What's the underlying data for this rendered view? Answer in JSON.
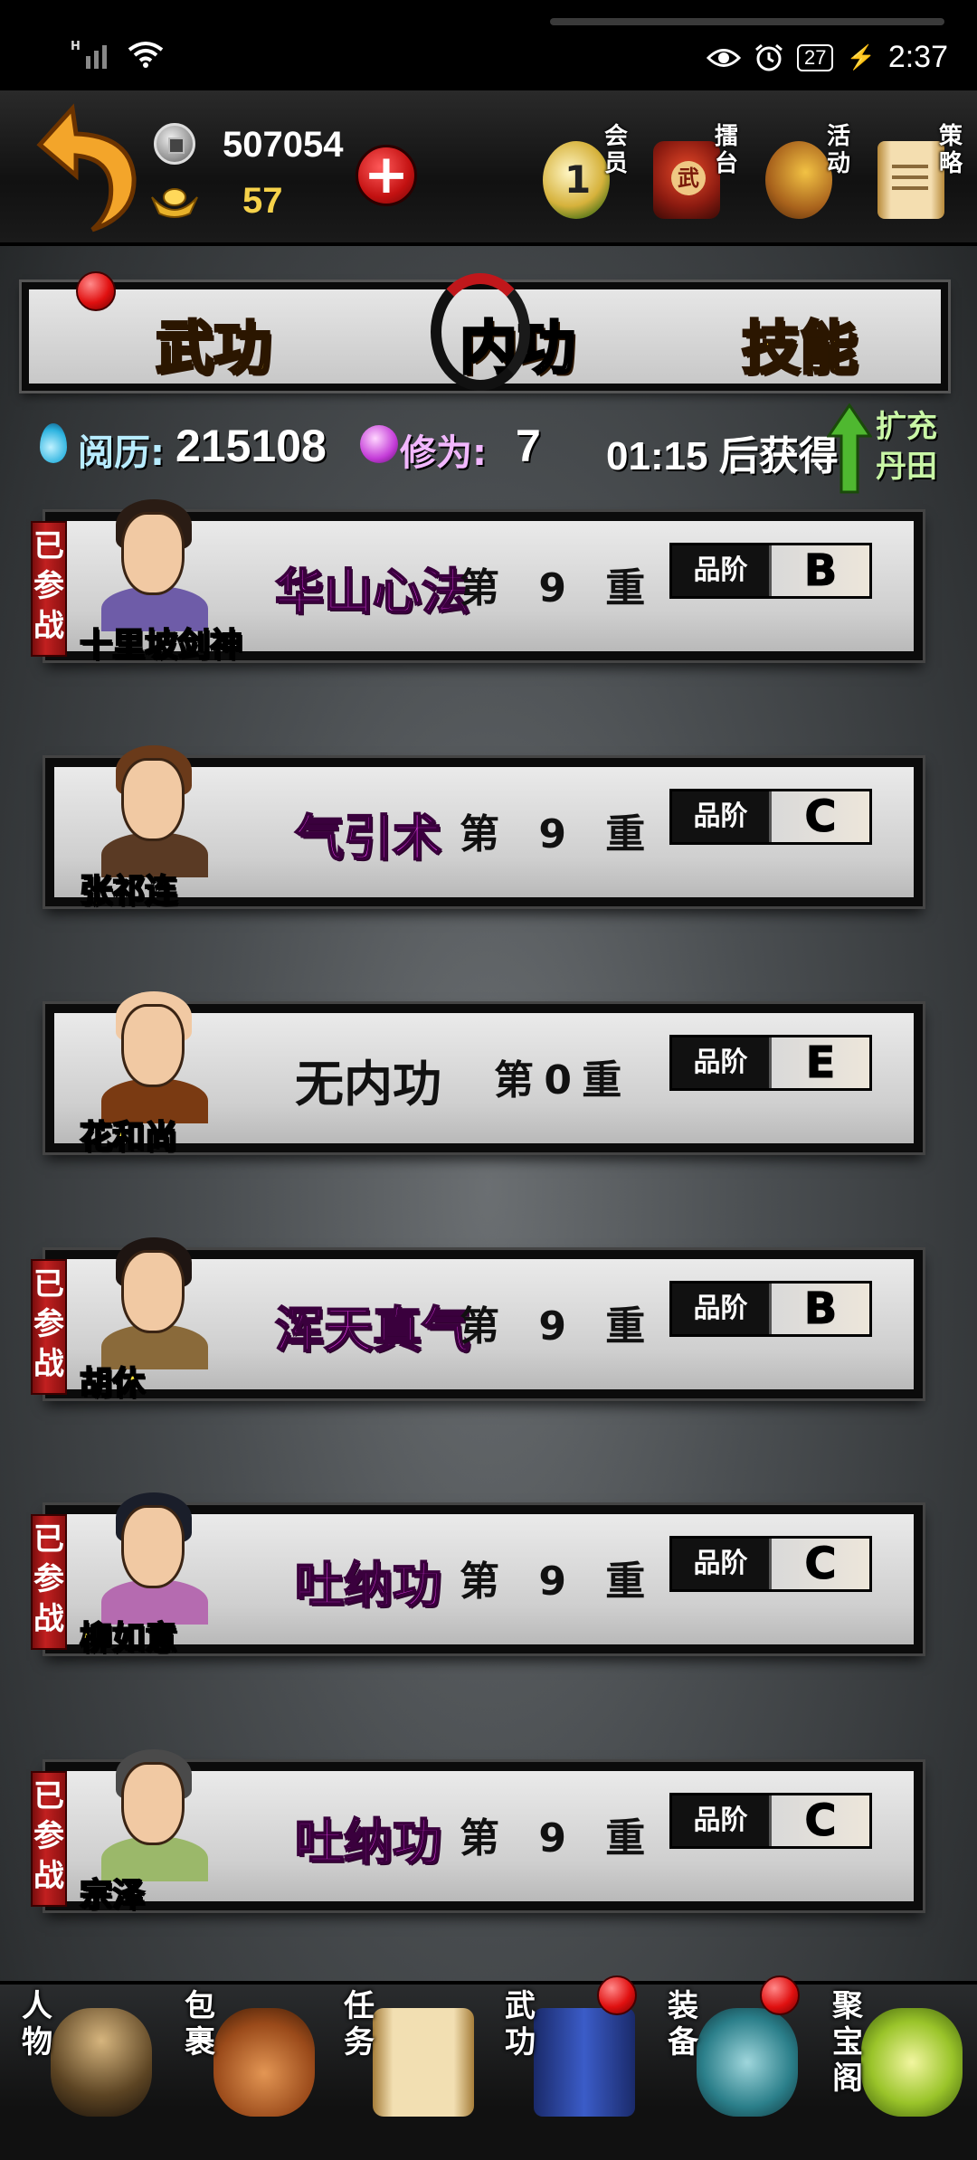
{
  "status_bar": {
    "network": "H",
    "battery": "27",
    "time": "2:37"
  },
  "resources": {
    "silver": "507054",
    "gold": "57"
  },
  "top_menu": [
    {
      "label": "会员",
      "icon": "vip-icon"
    },
    {
      "label": "擂台",
      "icon": "arena-drum-icon"
    },
    {
      "label": "活动",
      "icon": "event-fan-icon"
    },
    {
      "label": "策略",
      "icon": "scroll-icon"
    }
  ],
  "tabs": [
    {
      "label": "武功",
      "has_badge": true
    },
    {
      "label": "内功",
      "selected": true
    },
    {
      "label": "技能"
    }
  ],
  "stats": {
    "experience_label": "阅历:",
    "experience_value": "215108",
    "cultivation_label": "修为:",
    "cultivation_value": "7",
    "timer": "01:15",
    "timer_suffix": "后获得",
    "expand_label": "扩充丹田"
  },
  "grade_label": "品阶",
  "deployed_label": "已参战",
  "characters": [
    {
      "name": "十里坡剑神",
      "skill": "华山心法",
      "level_prefix": "第",
      "level": "9",
      "level_suffix": "重",
      "grade": "B",
      "deployed": true
    },
    {
      "name": "张祁连",
      "skill": "气引术",
      "level_prefix": "第",
      "level": "9",
      "level_suffix": "重",
      "grade": "C",
      "deployed": false
    },
    {
      "name": "花和尚",
      "skill": "无内功",
      "level_prefix": "第",
      "level": "0",
      "level_suffix": "重",
      "grade": "E",
      "deployed": false
    },
    {
      "name": "胡休",
      "skill": "浑天真气",
      "level_prefix": "第",
      "level": "9",
      "level_suffix": "重",
      "grade": "B",
      "deployed": true
    },
    {
      "name": "柳如意",
      "skill": "吐纳功",
      "level_prefix": "第",
      "level": "9",
      "level_suffix": "重",
      "grade": "C",
      "deployed": true
    },
    {
      "name": "宗泽",
      "skill": "吐纳功",
      "level_prefix": "第",
      "level": "9",
      "level_suffix": "重",
      "grade": "C",
      "deployed": true
    }
  ],
  "bottom_nav": [
    {
      "label": "人物",
      "icon": "character-icon",
      "badge": false
    },
    {
      "label": "包裹",
      "icon": "bag-icon",
      "badge": false
    },
    {
      "label": "任务",
      "icon": "quest-scroll-icon",
      "badge": false
    },
    {
      "label": "武功",
      "icon": "martial-book-icon",
      "badge": true
    },
    {
      "label": "装备",
      "icon": "equipment-icon",
      "badge": true
    },
    {
      "label": "聚宝阁",
      "icon": "treasure-icon",
      "badge": false
    }
  ],
  "colors": {
    "skill_text": "#f23ff8",
    "name_text": "#ffe83a",
    "tab_text": "#f7c93a",
    "badge_red": "#c22020"
  }
}
